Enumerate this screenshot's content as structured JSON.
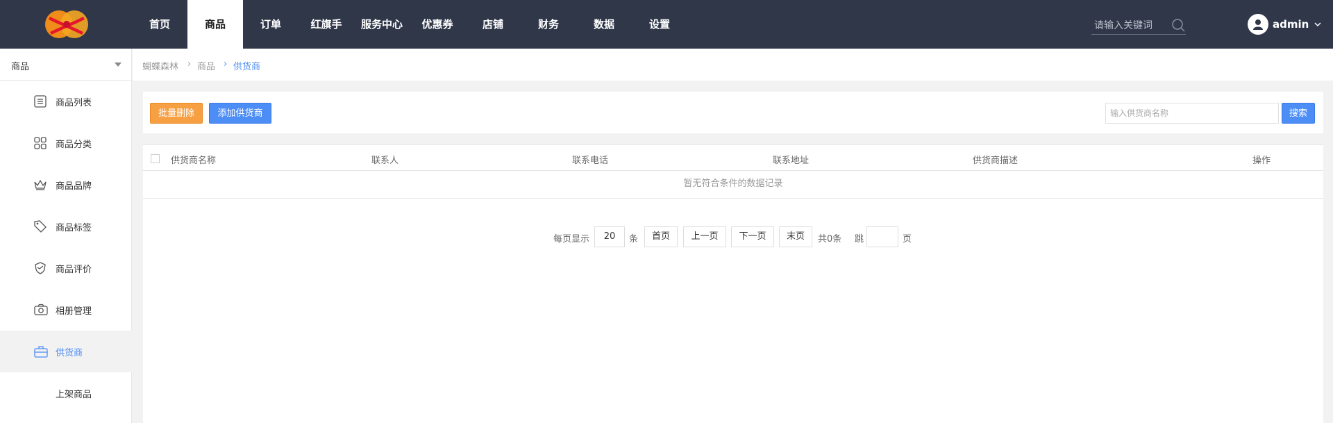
{
  "header": {
    "nav": [
      "首页",
      "商品",
      "订单",
      "红旗手",
      "服务中心",
      "优惠券",
      "店铺",
      "财务",
      "数据",
      "设置"
    ],
    "active_nav_index": 1,
    "search_placeholder": "请输入关键词",
    "username": "admin"
  },
  "sidebar": {
    "section_label": "商品",
    "items": [
      {
        "label": "商品列表",
        "icon": "list-icon"
      },
      {
        "label": "商品分类",
        "icon": "grid-icon"
      },
      {
        "label": "商品品牌",
        "icon": "crown-icon"
      },
      {
        "label": "商品标签",
        "icon": "tag-icon"
      },
      {
        "label": "商品评价",
        "icon": "shield-icon"
      },
      {
        "label": "相册管理",
        "icon": "camera-icon"
      },
      {
        "label": "供货商",
        "icon": "briefcase-icon"
      },
      {
        "label": "上架商品",
        "icon": ""
      }
    ],
    "active_index": 6
  },
  "breadcrumb": {
    "items": [
      "蝴蝶森林",
      "商品",
      "供货商"
    ]
  },
  "toolbar": {
    "batch_delete_label": "批量删除",
    "add_supplier_label": "添加供货商",
    "search_placeholder": "输入供货商名称",
    "search_label": "搜索"
  },
  "table": {
    "columns": [
      "供货商名称",
      "联系人",
      "联系电话",
      "联系地址",
      "供货商描述",
      "操作"
    ],
    "rows": [],
    "empty_text": "暂无符合条件的数据记录"
  },
  "pagination": {
    "per_page_label": "每页显示",
    "per_page_value": "20",
    "per_page_unit": "条",
    "first_label": "首页",
    "prev_label": "上一页",
    "next_label": "下一页",
    "last_label": "末页",
    "total_text": "共0条",
    "jump_label": "跳",
    "jump_value": "",
    "page_unit": "页"
  },
  "colors": {
    "topbar": "#2f3749",
    "accent": "#4c8df6",
    "warning": "#f7a043"
  }
}
